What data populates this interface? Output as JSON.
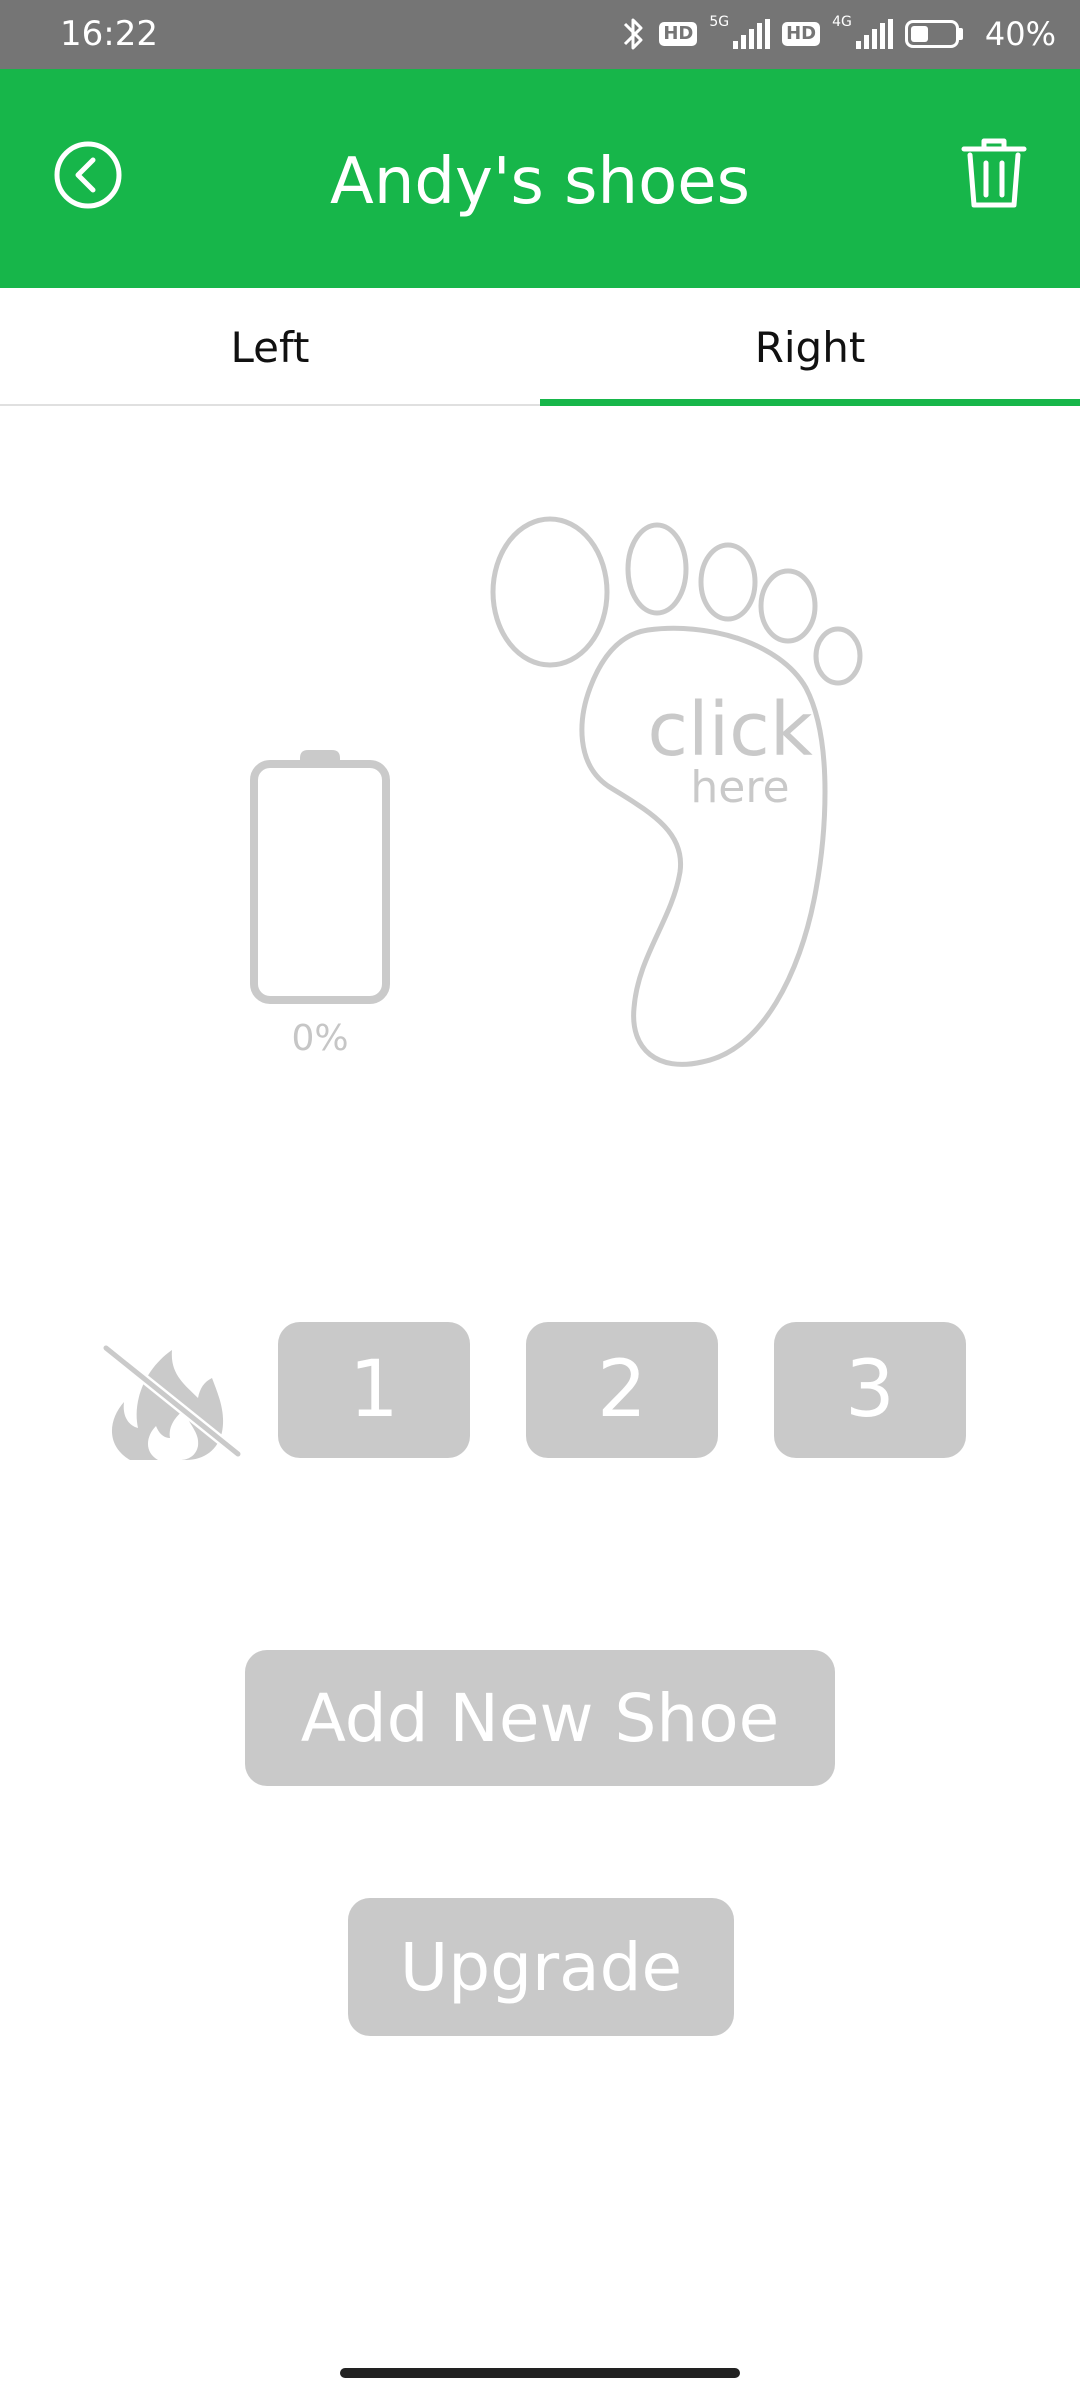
{
  "status_bar": {
    "time": "16:22",
    "hd_badge_1": "HD",
    "network_1": "5G",
    "hd_badge_2": "HD",
    "network_2": "4G",
    "battery_percent": "40%",
    "battery_level": 0.4
  },
  "header": {
    "title": "Andy's shoes",
    "back_icon": "circle-chevron-left-icon",
    "delete_icon": "trash-icon",
    "background_color": "#17b64a"
  },
  "tabs": {
    "items": [
      {
        "label": "Left",
        "selected": false
      },
      {
        "label": "Right",
        "selected": true
      }
    ],
    "indicator_color": "#17b64a"
  },
  "device": {
    "battery_label": "0%",
    "battery_level": 0,
    "foot_text_line1": "click",
    "foot_text_line2": "here"
  },
  "heat_levels": {
    "off_icon": "no-fire-icon",
    "levels": [
      "1",
      "2",
      "3"
    ]
  },
  "actions": {
    "add_new_shoe": "Add New Shoe",
    "upgrade": "Upgrade"
  },
  "colors": {
    "disabled_gray": "#c9c9c9",
    "status_bar": "#757575"
  }
}
